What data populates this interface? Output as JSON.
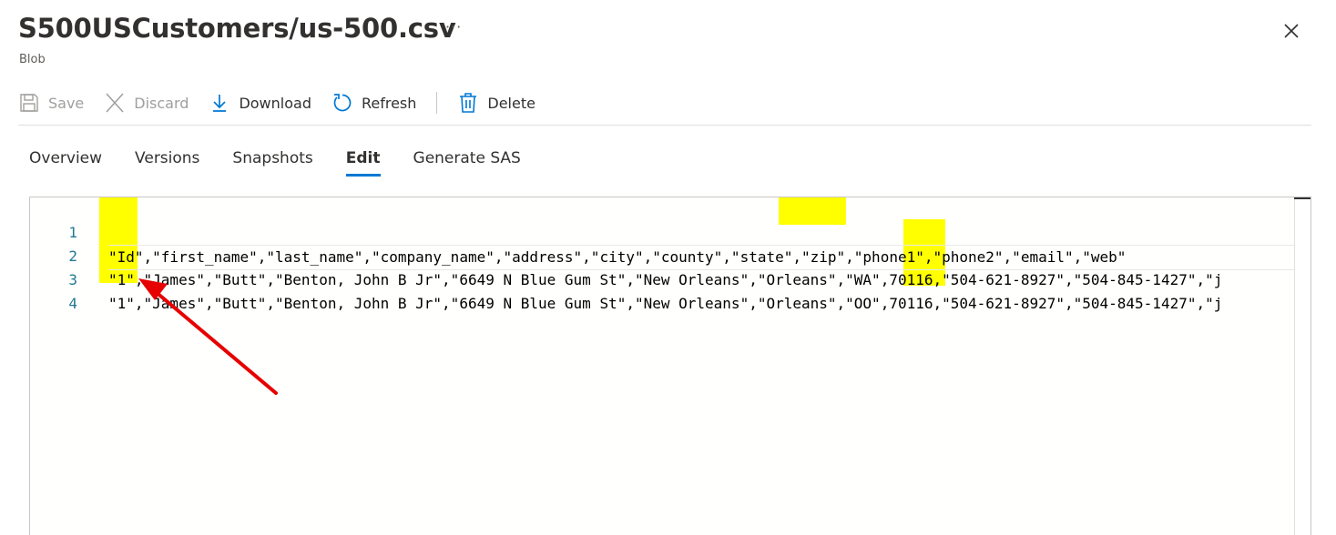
{
  "header": {
    "title": "S500USCustomers/us-500.csv",
    "more_label": "···",
    "subtitle": "Blob",
    "close_icon": "close-icon"
  },
  "toolbar": {
    "save_label": "Save",
    "discard_label": "Discard",
    "download_label": "Download",
    "refresh_label": "Refresh",
    "delete_label": "Delete"
  },
  "tabs": [
    {
      "label": "Overview",
      "active": false
    },
    {
      "label": "Versions",
      "active": false
    },
    {
      "label": "Snapshots",
      "active": false
    },
    {
      "label": "Edit",
      "active": true
    },
    {
      "label": "Generate SAS",
      "active": false
    }
  ],
  "editor": {
    "lines": [
      {
        "number": "1",
        "text": "\"Id\",\"first_name\",\"last_name\",\"company_name\",\"address\",\"city\",\"county\",\"state\",\"zip\",\"phone1\",\"phone2\",\"email\",\"web\""
      },
      {
        "number": "2",
        "text": "\"1\",\"James\",\"Butt\",\"Benton, John B Jr\",\"6649 N Blue Gum St\",\"New Orleans\",\"Orleans\",\"WA\",70116,\"504-621-8927\",\"504-845-1427\",\"j"
      },
      {
        "number": "3",
        "text": "\"1\",\"James\",\"Butt\",\"Benton, John B Jr\",\"6649 N Blue Gum St\",\"New Orleans\",\"Orleans\",\"OO\",70116,\"504-621-8927\",\"504-845-1427\",\"j"
      },
      {
        "number": "4",
        "text": ""
      }
    ]
  },
  "colors": {
    "accent": "#0078d4",
    "highlight": "#ffff00",
    "annotation_arrow": "#e60000",
    "line_number": "#237893"
  }
}
